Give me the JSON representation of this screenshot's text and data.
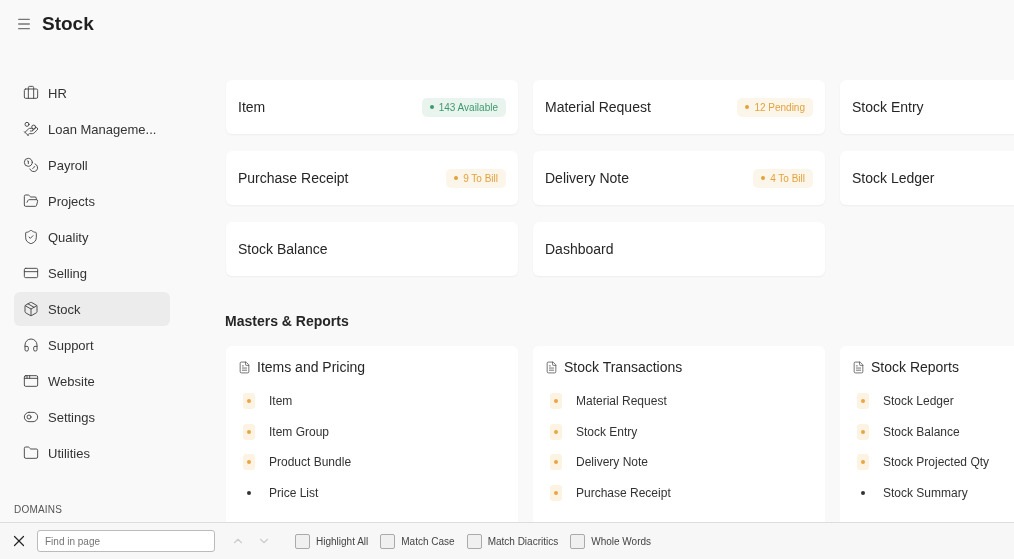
{
  "header": {
    "title": "Stock"
  },
  "sidebar": {
    "items": [
      {
        "label": "HR",
        "selected": false
      },
      {
        "label": "Loan Manageme...",
        "selected": false
      },
      {
        "label": "Payroll",
        "selected": false
      },
      {
        "label": "Projects",
        "selected": false
      },
      {
        "label": "Quality",
        "selected": false
      },
      {
        "label": "Selling",
        "selected": false
      },
      {
        "label": "Stock",
        "selected": true
      },
      {
        "label": "Support",
        "selected": false
      },
      {
        "label": "Website",
        "selected": false
      },
      {
        "label": "Settings",
        "selected": false
      },
      {
        "label": "Utilities",
        "selected": false
      }
    ],
    "section_label": "DOMAINS"
  },
  "shortcuts": [
    {
      "label": "Item",
      "badge": "143 Available",
      "color": "#3d9a6e"
    },
    {
      "label": "Material Request",
      "badge": "12 Pending",
      "color": "#e3a23c"
    },
    {
      "label": "Stock Entry"
    },
    {
      "label": "Purchase Receipt",
      "badge": "9 To Bill",
      "color": "#e3a23c"
    },
    {
      "label": "Delivery Note",
      "badge": "4 To Bill",
      "color": "#e3a23c"
    },
    {
      "label": "Stock Ledger"
    },
    {
      "label": "Stock Balance"
    },
    {
      "label": "Dashboard"
    }
  ],
  "reports": {
    "title": "Masters & Reports",
    "cards": [
      {
        "title": "Items and Pricing",
        "links": [
          {
            "label": "Item",
            "color": "#e8a648"
          },
          {
            "label": "Item Group",
            "color": "#e8a648"
          },
          {
            "label": "Product Bundle",
            "color": "#e8a648"
          },
          {
            "label": "Price List",
            "color": "#333333"
          }
        ]
      },
      {
        "title": "Stock Transactions",
        "links": [
          {
            "label": "Material Request",
            "color": "#e8a648"
          },
          {
            "label": "Stock Entry",
            "color": "#e8a648"
          },
          {
            "label": "Delivery Note",
            "color": "#e8a648"
          },
          {
            "label": "Purchase Receipt",
            "color": "#e8a648"
          }
        ]
      },
      {
        "title": "Stock Reports",
        "links": [
          {
            "label": "Stock Ledger",
            "color": "#e8a648"
          },
          {
            "label": "Stock Balance",
            "color": "#e8a648"
          },
          {
            "label": "Stock Projected Qty",
            "color": "#e8a648"
          },
          {
            "label": "Stock Summary",
            "color": "#333333"
          }
        ]
      }
    ]
  },
  "find_bar": {
    "placeholder": "Find in page",
    "options": [
      {
        "label": "Highlight All",
        "checked": false
      },
      {
        "label": "Match Case",
        "checked": false
      },
      {
        "label": "Match Diacritics",
        "checked": false
      },
      {
        "label": "Whole Words",
        "checked": false
      }
    ]
  }
}
